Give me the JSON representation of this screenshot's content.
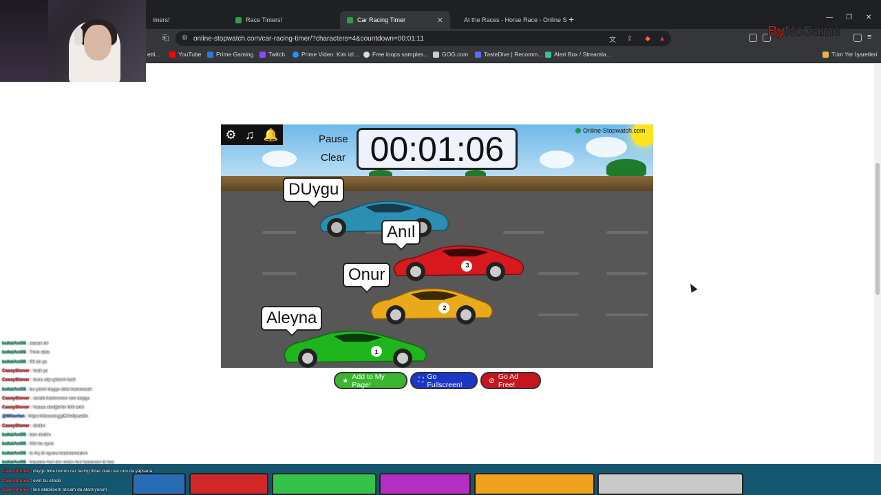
{
  "browser": {
    "tabs": [
      {
        "label": "imers!",
        "active": false
      },
      {
        "label": "Race Timers!",
        "active": false
      },
      {
        "label": "Car Racing Timer",
        "active": true
      },
      {
        "label": "At the Races - Horse Race - Online S",
        "active": false
      }
    ],
    "url": "online-stopwatch.com/car-racing-timer/?characters=4&countdown=00:01:11",
    "bookmarks": [
      "etti...",
      "YouTube",
      "Prime Gaming",
      "Twitch",
      "Prime Video: Kim izl...",
      "Free loops samples...",
      "GOG.com",
      "TasteDive | Recomm...",
      "Alert Box / Streamla..."
    ],
    "all_bookmarks": "Tüm Yer İşaretleri"
  },
  "overlay_logo": {
    "by": "By",
    "no": "No",
    "game": "Game"
  },
  "game": {
    "pause_label": "Pause",
    "clear_label": "Clear",
    "timer": "00:01:06",
    "brand": "Online-Stopwatch.com",
    "racers": [
      {
        "name": "DUygu",
        "number": "",
        "color": "#2b8fb3"
      },
      {
        "name": "Anıl",
        "number": "3",
        "color": "#d8191d"
      },
      {
        "name": "Onur",
        "number": "2",
        "color": "#e8a91a"
      },
      {
        "name": "Aleyna",
        "number": "1",
        "color": "#1fb51d"
      }
    ]
  },
  "buttons": {
    "add": "Add to My Page!",
    "fullscreen": "Go Fullscreen!",
    "adfree": "Go Ad Free!"
  },
  "chat": [
    {
      "user": "baltalAni06",
      "msg": ": aaaaa de",
      "color": "#20c997"
    },
    {
      "user": "baltalAni06",
      "msg": ": Tmm abla",
      "color": "#20c997"
    },
    {
      "user": "baltalAni06",
      "msg": ": 06 de ya",
      "color": "#20c997"
    },
    {
      "user": "CaseyStoner",
      "msg": ": hadi ya",
      "color": "#ff4040"
    },
    {
      "user": "CaseyStoner",
      "msg": ": bunu alip gitcem hadi",
      "color": "#ff4040"
    },
    {
      "user": "baltalAni06",
      "msg": ": bu yarisi duygu abla kazanacak",
      "color": "#20c997"
    },
    {
      "user": "CaseyStoner",
      "msg": ": sonda bastırırsan sen duygu",
      "color": "#ff4040"
    },
    {
      "user": "CaseyStoner",
      "msg": ": haaaa akciğerler bitti amk",
      "color": "#ff4040"
    },
    {
      "user": "@Milanfan",
      "msg": ": https://discord.gg/EXe9puat3x",
      "color": "#3b82f6"
    },
    {
      "user": "CaseyStoner",
      "msg": ": dedim",
      "color": "#ff4040"
    },
    {
      "user": "baltalAni06",
      "msg": ": ben dedim",
      "color": "#20c997"
    },
    {
      "user": "baltalAni06",
      "msg": ": hile bu oyun",
      "color": "#20c997"
    },
    {
      "user": "baltalAni06",
      "msg": ": ia hiç bi oyunu kazanamadım",
      "color": "#20c997"
    },
    {
      "user": "baltalAni06",
      "msg": ": hepsine Anıl der misin Anıl kazansın bi kez",
      "color": "#20c997"
    },
    {
      "user": "CaseyStoner",
      "msg": ": duygu bide bunun car racing timer olanı var onu da yapsana",
      "color": "#ff4040"
    },
    {
      "user": "CaseyStoner",
      "msg": ": evet bu sitede",
      "color": "#ff4040"
    },
    {
      "user": "CaseyStoner",
      "msg": ": link atabilisem atıcam da atamıyorum",
      "color": "#ff4040"
    }
  ],
  "taskbar_colors": [
    "#2a6bb5",
    "#d02828",
    "#34c24a",
    "#b52ec2",
    "#f0a21e",
    "#c9c9c9"
  ]
}
